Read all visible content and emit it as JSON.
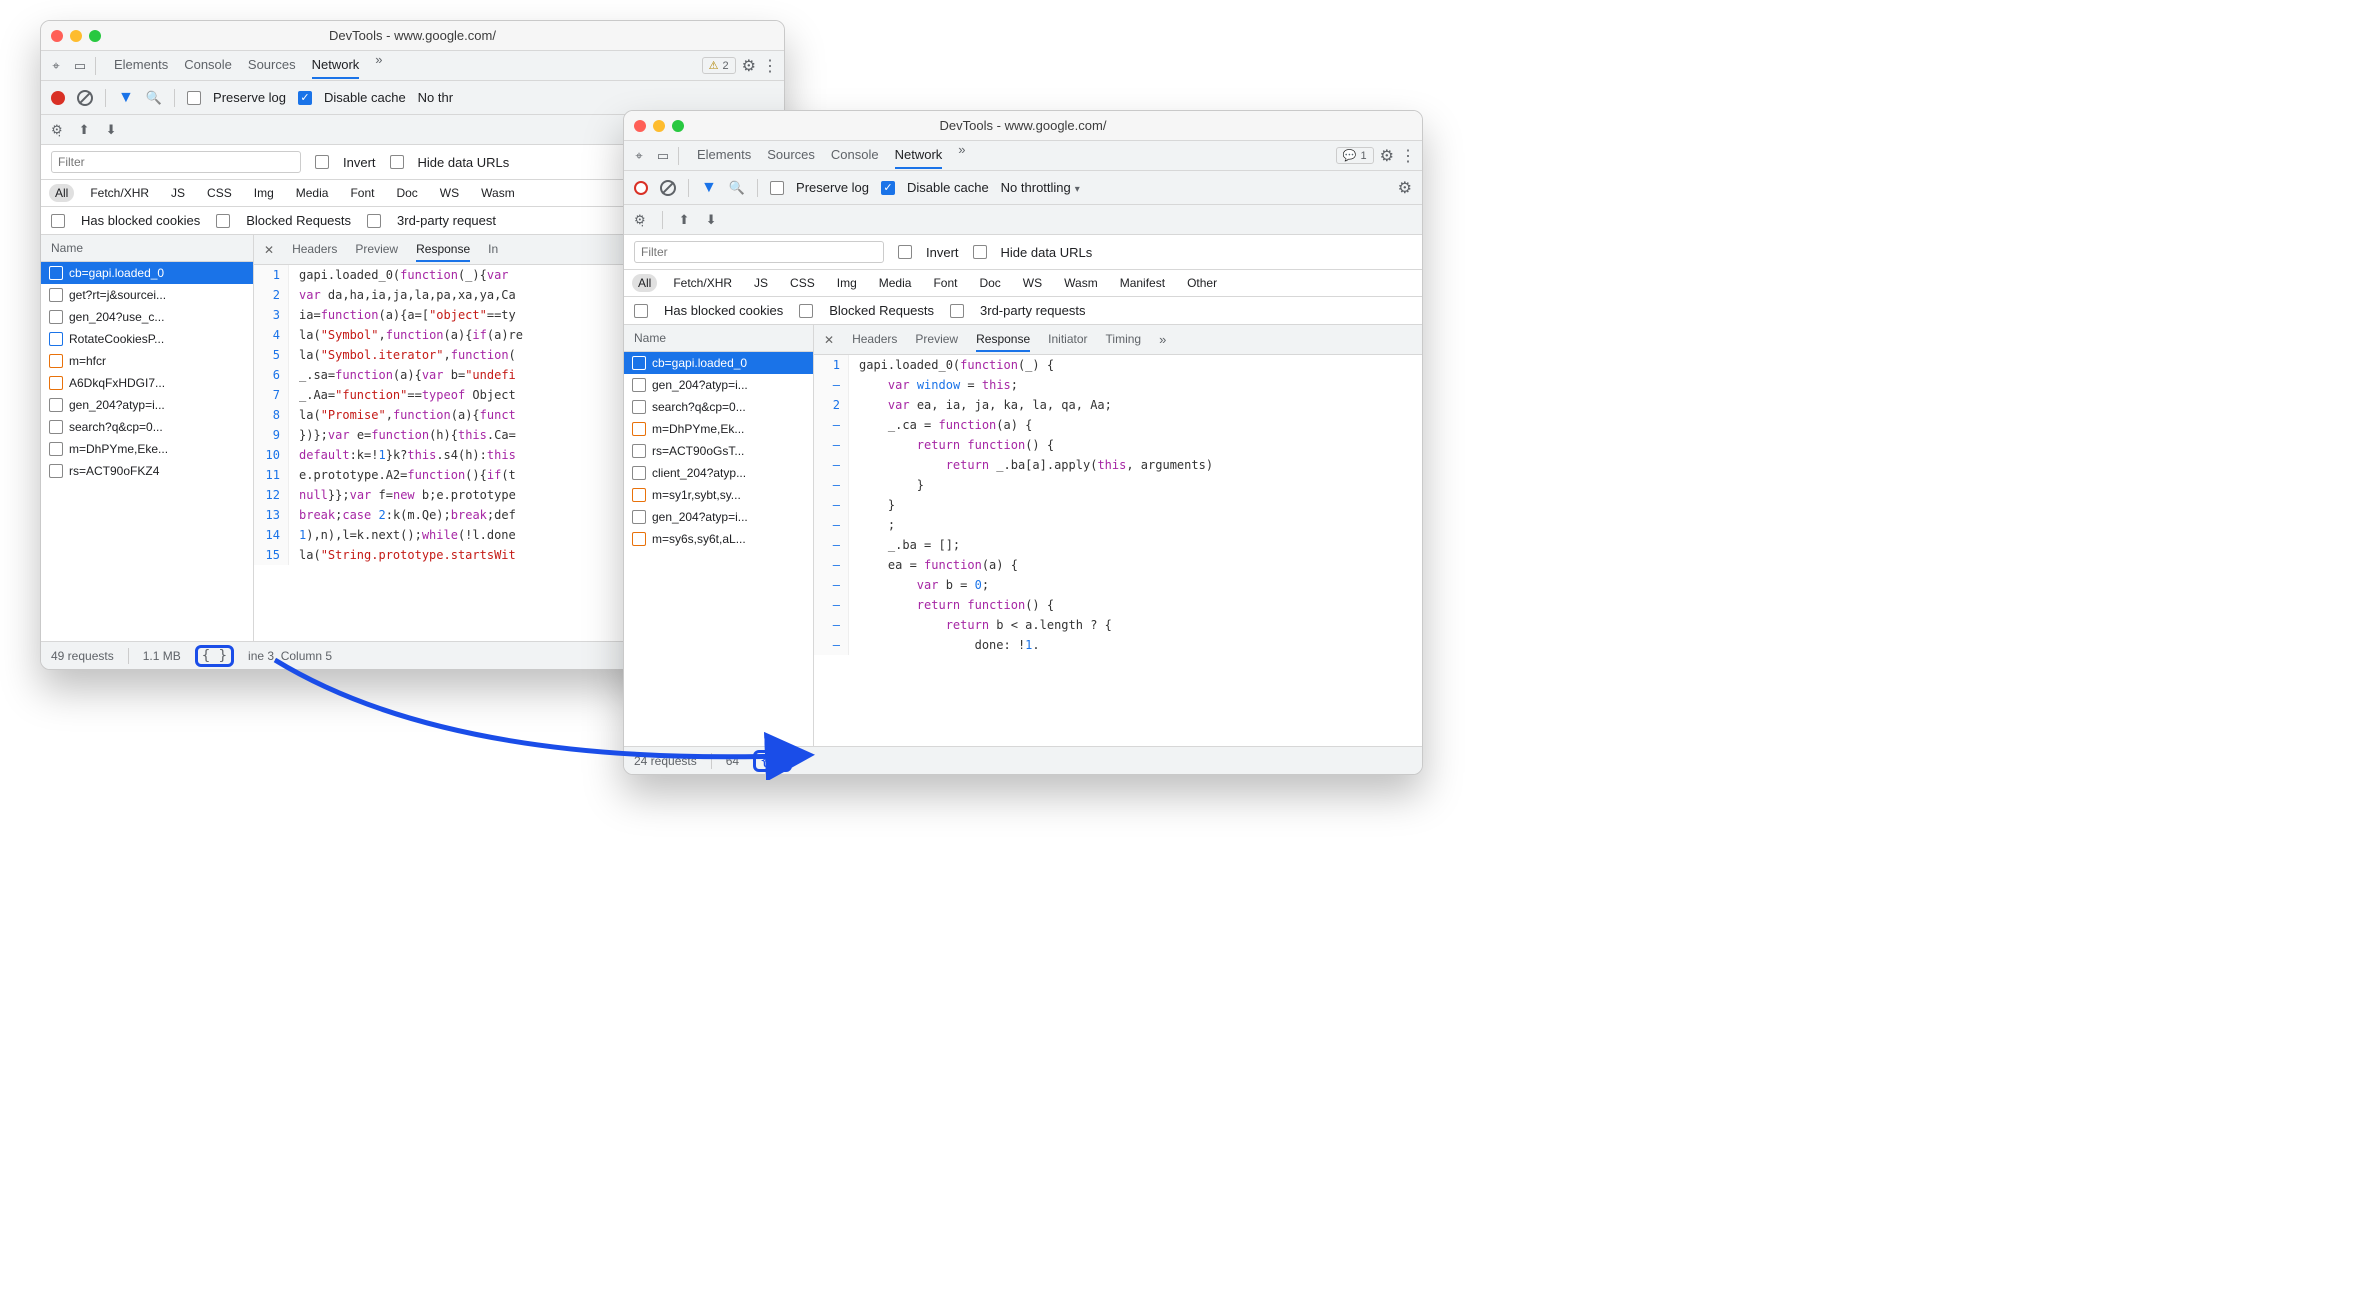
{
  "shared": {
    "windowTitle": "DevTools - www.google.com/"
  },
  "w1": {
    "tabs": {
      "a": "Elements",
      "b": "Console",
      "c": "Sources",
      "d": "Network"
    },
    "badge": "2",
    "toolbar": {
      "preserve": "Preserve log",
      "disable": "Disable cache",
      "throttle": "No thr"
    },
    "filter": {
      "placeholder": "Filter",
      "invert": "Invert",
      "hide": "Hide data URLs"
    },
    "chips": {
      "all": "All",
      "fx": "Fetch/XHR",
      "js": "JS",
      "css": "CSS",
      "img": "Img",
      "media": "Media",
      "font": "Font",
      "doc": "Doc",
      "ws": "WS",
      "wasm": "Wasm"
    },
    "checks": {
      "a": "Has blocked cookies",
      "b": "Blocked Requests",
      "c": "3rd-party request"
    },
    "nameHeader": "Name",
    "rows": [
      {
        "t": "cb=gapi.loaded_0",
        "c": "orange",
        "sel": true
      },
      {
        "t": "get?rt=j&sourcei...",
        "c": "gray"
      },
      {
        "t": "gen_204?use_c...",
        "c": "gray"
      },
      {
        "t": "RotateCookiesP...",
        "c": "blue"
      },
      {
        "t": "m=hfcr",
        "c": "orange"
      },
      {
        "t": "A6DkqFxHDGI7...",
        "c": "orange"
      },
      {
        "t": "gen_204?atyp=i...",
        "c": "gray"
      },
      {
        "t": "search?q&cp=0...",
        "c": "gray"
      },
      {
        "t": "m=DhPYme,Eke...",
        "c": "gray"
      },
      {
        "t": "rs=ACT90oFKZ4",
        "c": "gray"
      }
    ],
    "detail": {
      "headers": "Headers",
      "preview": "Preview",
      "response": "Response",
      "in": "In"
    },
    "status": {
      "req": "49 requests",
      "sz": "1.1 MB",
      "cursor": "ine 3, Column 5"
    },
    "code": [
      {
        "n": "1",
        "h": "gapi.loaded_0(<span class='kw'>function</span>(_){<span class='kw'>var</span> "
      },
      {
        "n": "2",
        "h": "<span class='kw'>var</span> da,ha,ia,ja,la,pa,xa,ya,Ca"
      },
      {
        "n": "3",
        "h": "ia=<span class='kw'>function</span>(a){a=[<span class='str'>\"object\"</span>==ty"
      },
      {
        "n": "4",
        "h": "la(<span class='str'>\"Symbol\"</span>,<span class='kw'>function</span>(a){<span class='kw'>if</span>(a)re"
      },
      {
        "n": "5",
        "h": "la(<span class='str'>\"Symbol.iterator\"</span>,<span class='kw'>function</span>("
      },
      {
        "n": "6",
        "h": "_.sa=<span class='kw'>function</span>(a){<span class='kw'>var</span> b=<span class='str'>\"undefi</span>"
      },
      {
        "n": "7",
        "h": "_.Aa=<span class='str'>\"function\"</span>==<span class='kw'>typeof</span> Object"
      },
      {
        "n": "8",
        "h": "la(<span class='str'>\"Promise\"</span>,<span class='kw'>function</span>(a){<span class='kw'>funct</span>"
      },
      {
        "n": "9",
        "h": "})};<span class='kw'>var</span> e=<span class='kw'>function</span>(h){<span class='kw'>this</span>.Ca="
      },
      {
        "n": "10",
        "h": "<span class='kw'>default</span>:k=!<span class='num'>1</span>}k?<span class='kw'>this</span>.s4(h):<span class='kw'>this</span>"
      },
      {
        "n": "11",
        "h": "e.prototype.A2=<span class='kw'>function</span>(){<span class='kw'>if</span>(t"
      },
      {
        "n": "12",
        "h": "<span class='kw'>null</span>}};<span class='kw'>var</span> f=<span class='kw'>new</span> b;e.prototype"
      },
      {
        "n": "13",
        "h": "<span class='kw'>break</span>;<span class='kw'>case</span> <span class='num'>2</span>:k(m.Qe);<span class='kw'>break</span>;def"
      },
      {
        "n": "14",
        "h": "<span class='num'>1</span>),n),l=k.next();<span class='kw'>while</span>(!l.done"
      },
      {
        "n": "15",
        "h": "la(<span class='str'>\"String.prototype.startsWit</span>"
      }
    ]
  },
  "w2": {
    "tabs": {
      "a": "Elements",
      "b": "Sources",
      "c": "Console",
      "d": "Network"
    },
    "badge": "1",
    "toolbar": {
      "preserve": "Preserve log",
      "disable": "Disable cache",
      "throttle": "No throttling"
    },
    "filter": {
      "placeholder": "Filter",
      "invert": "Invert",
      "hide": "Hide data URLs"
    },
    "chips": {
      "all": "All",
      "fx": "Fetch/XHR",
      "js": "JS",
      "css": "CSS",
      "img": "Img",
      "media": "Media",
      "font": "Font",
      "doc": "Doc",
      "ws": "WS",
      "wasm": "Wasm",
      "man": "Manifest",
      "other": "Other"
    },
    "checks": {
      "a": "Has blocked cookies",
      "b": "Blocked Requests",
      "c": "3rd-party requests"
    },
    "nameHeader": "Name",
    "rows": [
      {
        "t": "cb=gapi.loaded_0",
        "c": "orange",
        "sel": true
      },
      {
        "t": "gen_204?atyp=i...",
        "c": "gray"
      },
      {
        "t": "search?q&cp=0...",
        "c": "gray"
      },
      {
        "t": "m=DhPYme,Ek...",
        "c": "orange"
      },
      {
        "t": "rs=ACT90oGsT...",
        "c": "gray"
      },
      {
        "t": "client_204?atyp...",
        "c": "gray"
      },
      {
        "t": "m=sy1r,sybt,sy...",
        "c": "orange"
      },
      {
        "t": "gen_204?atyp=i...",
        "c": "gray"
      },
      {
        "t": "m=sy6s,sy6t,aL...",
        "c": "orange"
      }
    ],
    "detail": {
      "headers": "Headers",
      "preview": "Preview",
      "response": "Response",
      "init": "Initiator",
      "timing": "Timing"
    },
    "status": {
      "req": "24 requests",
      "sz": "64"
    },
    "code": [
      {
        "n": "1",
        "h": "gapi.loaded_0(<span class='kw'>function</span>(_) {"
      },
      {
        "n": "–",
        "h": "    <span class='kw'>var</span> <span class='def'>window</span> = <span class='kw'>this</span>;"
      },
      {
        "n": "2",
        "h": "    <span class='kw'>var</span> ea, ia, ja, ka, la, qa, Aa;"
      },
      {
        "n": "–",
        "h": "    _.ca = <span class='kw'>function</span>(a) {"
      },
      {
        "n": "–",
        "h": "        <span class='kw'>return</span> <span class='kw'>function</span>() {"
      },
      {
        "n": "–",
        "h": "            <span class='kw'>return</span> _.ba[a].apply(<span class='kw'>this</span>, arguments)"
      },
      {
        "n": "–",
        "h": "        }"
      },
      {
        "n": "–",
        "h": "    }"
      },
      {
        "n": "–",
        "h": "    ;"
      },
      {
        "n": "–",
        "h": "    _.ba = [];"
      },
      {
        "n": "–",
        "h": "    ea = <span class='kw'>function</span>(a) {"
      },
      {
        "n": "–",
        "h": "        <span class='kw'>var</span> b = <span class='num'>0</span>;"
      },
      {
        "n": "–",
        "h": "        <span class='kw'>return</span> <span class='kw'>function</span>() {"
      },
      {
        "n": "–",
        "h": "            <span class='kw'>return</span> b &lt; a.length ? {"
      },
      {
        "n": "–",
        "h": "                done: !<span class='num'>1</span>."
      }
    ]
  },
  "bracesGlyph": "{ }"
}
